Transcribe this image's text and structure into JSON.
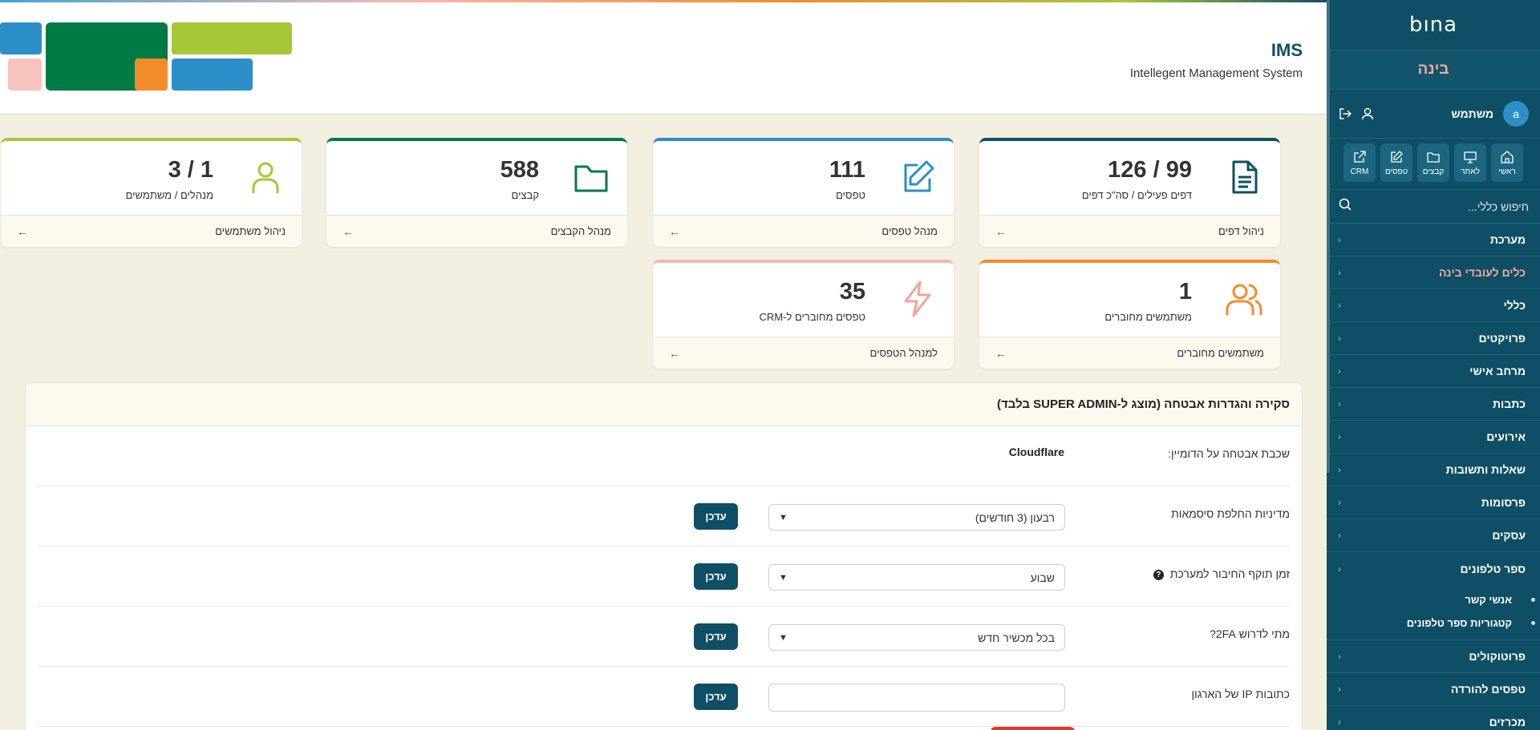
{
  "header": {
    "title": "IMS",
    "subtitle": "Intellegent Management System",
    "logo_colors": [
      "#2c8fc9",
      "#007a45",
      "#a6c737",
      "#f7c5c0",
      "#f28c28",
      "#2c8fc9"
    ]
  },
  "sidebar": {
    "logo_text": "bına",
    "brand": "בינה",
    "user": {
      "avatar_letter": "a",
      "name": "משתמש"
    },
    "quick_links": [
      {
        "label": "ראשי",
        "icon": "home-icon"
      },
      {
        "label": "לאתר",
        "icon": "monitor-icon"
      },
      {
        "label": "קבצים",
        "icon": "folder-icon"
      },
      {
        "label": "טפסים",
        "icon": "edit-icon"
      },
      {
        "label": "CRM",
        "icon": "external-link-icon"
      }
    ],
    "search_placeholder": "חיפוש כללי...",
    "nav_items": [
      {
        "label": "מערכת"
      },
      {
        "label": "כלים לעובדי בינה"
      },
      {
        "label": "כללי"
      },
      {
        "label": "פרויקטים"
      },
      {
        "label": "מרחב אישי"
      },
      {
        "label": "כתבות"
      },
      {
        "label": "אירועים"
      },
      {
        "label": "שאלות ותשובות"
      },
      {
        "label": "פרסומות"
      },
      {
        "label": "עסקים"
      },
      {
        "label": "ספר טלפונים"
      }
    ],
    "sub_items": [
      {
        "label": "אנשי קשר"
      },
      {
        "label": "קטגוריות ספר טלפונים"
      }
    ],
    "nav_items_after": [
      {
        "label": "פרוטוקולים"
      },
      {
        "label": "טפסים להורדה"
      },
      {
        "label": "מכרזים"
      }
    ]
  },
  "cards": [
    {
      "value": "126 / 99",
      "label": "דפים פעילים / סה\"כ דפים",
      "link": "ניהול דפים",
      "color": "#0f4f65",
      "icon": "document-icon"
    },
    {
      "value": "111",
      "label": "טפסים",
      "link": "מנהל טפסים",
      "color": "#2c8fc9",
      "icon": "edit-icon"
    },
    {
      "value": "588",
      "label": "קבצים",
      "link": "מנהל הקבצים",
      "color": "#007a45",
      "icon": "folder-icon"
    },
    {
      "value": "3 / 1",
      "label": "מנהלים / משתמשים",
      "link": "ניהול משתמשים",
      "color": "#a6c737",
      "icon": "user-icon"
    },
    {
      "value": "1",
      "label": "משתמשים מחוברים",
      "link": "משתמשים מחוברים",
      "color": "#f28c28",
      "icon": "users-icon"
    },
    {
      "value": "35",
      "label": "טפסים מחוברים ל-CRM",
      "link": "למנהל הטפסים",
      "color": "#f7b7b1",
      "icon": "bolt-icon"
    }
  ],
  "security": {
    "title": "סקירה והגדרות אבטחה (מוצג ל-SUPER ADMIN בלבד)",
    "rows": [
      {
        "label": "שכבת אבטחה על הדומיין:",
        "value": "Cloudflare"
      },
      {
        "label": "מדיניות החלפת סיסמאות",
        "selected": "רבעון (3 חודשים)",
        "button": "עדכן"
      },
      {
        "label": "זמן תוקף החיבור למערכת",
        "selected": "שבוע",
        "button": "עדכן"
      },
      {
        "label": "מתי לדרוש 2FA?",
        "selected": "בכל מכשיר חדש",
        "button": "עדכן"
      },
      {
        "label": "כתובות IP של הארגון",
        "input_value": "",
        "button": "עדכן"
      }
    ]
  }
}
